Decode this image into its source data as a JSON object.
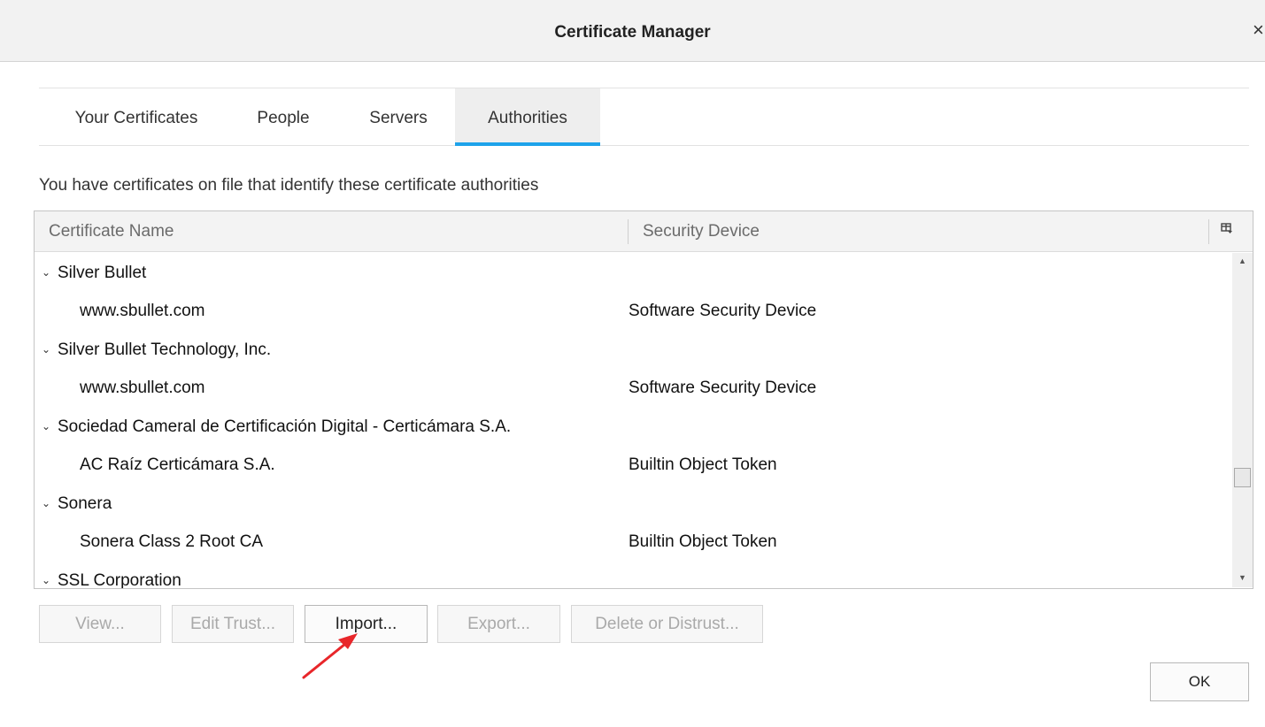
{
  "window": {
    "title": "Certificate Manager",
    "close_glyph": "×"
  },
  "tabs": [
    {
      "label": "Your Certificates",
      "selected": false
    },
    {
      "label": "People",
      "selected": false
    },
    {
      "label": "Servers",
      "selected": false
    },
    {
      "label": "Authorities",
      "selected": true
    }
  ],
  "description": "You have certificates on file that identify these certificate authorities",
  "table": {
    "columns": [
      "Certificate Name",
      "Security Device"
    ],
    "column_picker_icon": "column-picker-icon",
    "rows": [
      {
        "type": "group",
        "name": "Silver Bullet",
        "device": ""
      },
      {
        "type": "child",
        "name": "www.sbullet.com",
        "device": "Software Security Device"
      },
      {
        "type": "group",
        "name": "Silver Bullet Technology, Inc.",
        "device": ""
      },
      {
        "type": "child",
        "name": "www.sbullet.com",
        "device": "Software Security Device"
      },
      {
        "type": "group",
        "name": "Sociedad Cameral de Certificación Digital - Certicámara S.A.",
        "device": ""
      },
      {
        "type": "child",
        "name": "AC Raíz Certicámara S.A.",
        "device": "Builtin Object Token"
      },
      {
        "type": "group",
        "name": "Sonera",
        "device": ""
      },
      {
        "type": "child",
        "name": "Sonera Class 2 Root CA",
        "device": "Builtin Object Token"
      },
      {
        "type": "group",
        "name": "SSL Corporation",
        "device": ""
      }
    ],
    "scroll_position": 0.62
  },
  "buttons": {
    "view": "View...",
    "edit_trust": "Edit Trust...",
    "import": "Import...",
    "export": "Export...",
    "delete": "Delete or Distrust...",
    "ok": "OK"
  },
  "colors": {
    "tab_accent": "#1ea3ea",
    "annotation_arrow": "#e8262a"
  }
}
